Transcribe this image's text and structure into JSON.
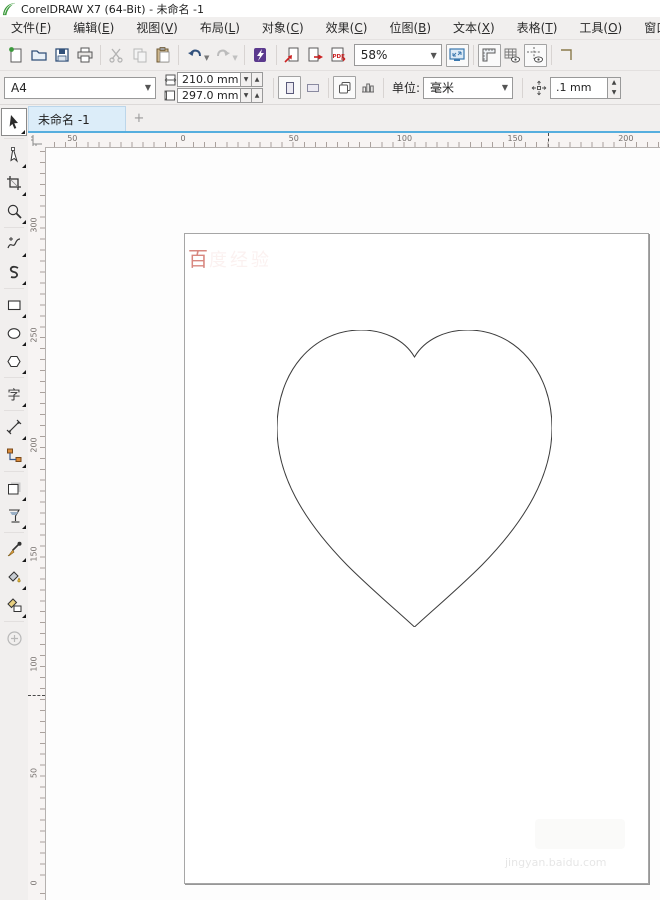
{
  "window": {
    "title": "CorelDRAW X7 (64-Bit) - 未命名 -1"
  },
  "menu": {
    "items": [
      {
        "label": "文件",
        "mnemonic": "F"
      },
      {
        "label": "编辑",
        "mnemonic": "E"
      },
      {
        "label": "视图",
        "mnemonic": "V"
      },
      {
        "label": "布局",
        "mnemonic": "L"
      },
      {
        "label": "对象",
        "mnemonic": "C"
      },
      {
        "label": "效果",
        "mnemonic": "C"
      },
      {
        "label": "位图",
        "mnemonic": "B"
      },
      {
        "label": "文本",
        "mnemonic": "X"
      },
      {
        "label": "表格",
        "mnemonic": "T"
      },
      {
        "label": "工具",
        "mnemonic": "O"
      },
      {
        "label": "窗口",
        "mnemonic": "W"
      }
    ]
  },
  "toolbar": {
    "zoom_level": "58%",
    "icons": [
      "new-document",
      "open",
      "save",
      "print",
      "cut",
      "copy",
      "paste",
      "undo",
      "redo",
      "search-content",
      "import",
      "export",
      "publish-pdf",
      "fullscreen-preview",
      "show-rulers",
      "show-grid",
      "show-guidelines"
    ]
  },
  "property_bar": {
    "paper_size": "A4",
    "page_width": "210.0 mm",
    "page_height": "297.0 mm",
    "units_label": "单位:",
    "units_value": "毫米",
    "nudge_offset": ".1 mm",
    "icons": [
      "page-width",
      "page-height",
      "portrait",
      "landscape",
      "all-pages",
      "current-page",
      "nudge-offset"
    ]
  },
  "document": {
    "tab_label": "未命名 -1",
    "new_tab_label": "+",
    "watermark_red": "百",
    "watermark_red_faint": "度经验",
    "watermark_gray": "jingyan.baidu.com"
  },
  "rulers": {
    "unit": "mm",
    "horizontal": [
      {
        "text": "50",
        "mm": -50
      },
      {
        "text": "0",
        "mm": 0
      },
      {
        "text": "50",
        "mm": 50
      },
      {
        "text": "100",
        "mm": 100
      },
      {
        "text": "150",
        "mm": 150
      },
      {
        "text": "200",
        "mm": 200
      }
    ],
    "vertical": [
      {
        "text": "300",
        "mm": 300
      },
      {
        "text": "250",
        "mm": 250
      },
      {
        "text": "200",
        "mm": 200
      },
      {
        "text": "150",
        "mm": 150
      },
      {
        "text": "100",
        "mm": 100
      },
      {
        "text": "50",
        "mm": 50
      },
      {
        "text": "0",
        "mm": 0
      }
    ]
  },
  "toolbox": {
    "selected": "pick",
    "tools": [
      "pick",
      "shape",
      "crop",
      "zoom",
      "freehand",
      "artistic-media",
      "rectangle",
      "ellipse",
      "polygon",
      "text",
      "parallel-dimension",
      "connector",
      "drop-shadow",
      "transparency",
      "color-eyedropper",
      "interactive-fill",
      "smart-fill",
      "quick-customize"
    ]
  },
  "canvas": {
    "shape": {
      "type": "heart-outline",
      "stroke": "#3c3c3c",
      "fill": "none"
    }
  },
  "colors": {
    "accent_tab_line": "#56aede",
    "logo_green": "#3c9a3c",
    "undo_blue": "#33527d",
    "disabled_gray": "#b5b5b5",
    "import_export_red": "#cc2222",
    "connect_purple": "#5b3a8e",
    "watermark_red": "#c03e30"
  }
}
